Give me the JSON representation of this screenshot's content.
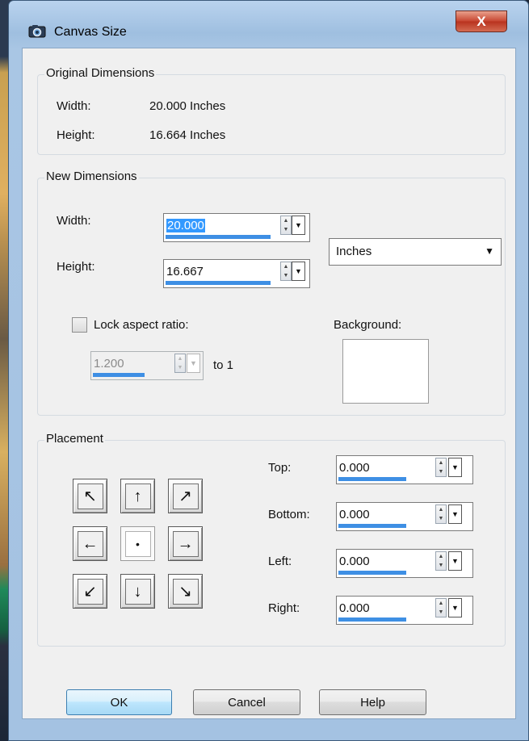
{
  "window": {
    "title": "Canvas Size",
    "close_label": "X"
  },
  "original": {
    "legend": "Original Dimensions",
    "width_label": "Width:",
    "width_value": "20.000 Inches",
    "height_label": "Height:",
    "height_value": "16.664 Inches"
  },
  "new_dimensions": {
    "legend": "New Dimensions",
    "width_label": "Width:",
    "width_value": "20.000",
    "height_label": "Height:",
    "height_value": "16.667",
    "units_value": "Inches",
    "lock_label": "Lock aspect ratio:",
    "lock_checked": false,
    "ratio_value": "1.200",
    "ratio_suffix": "to 1",
    "background_label": "Background:",
    "background_color": "#ffffff"
  },
  "placement": {
    "legend": "Placement",
    "arrows": [
      "↖",
      "↑",
      "↗",
      "←",
      "•",
      "→",
      "↙",
      "↓",
      "↘"
    ],
    "top_label": "Top:",
    "top_value": "0.000",
    "bottom_label": "Bottom:",
    "bottom_value": "0.000",
    "left_label": "Left:",
    "left_value": "0.000",
    "right_label": "Right:",
    "right_value": "0.000"
  },
  "buttons": {
    "ok": "OK",
    "cancel": "Cancel",
    "help": "Help"
  },
  "colors": {
    "accent": "#3399ff",
    "titlebar": "#a9c6e4",
    "close": "#c7442f"
  }
}
